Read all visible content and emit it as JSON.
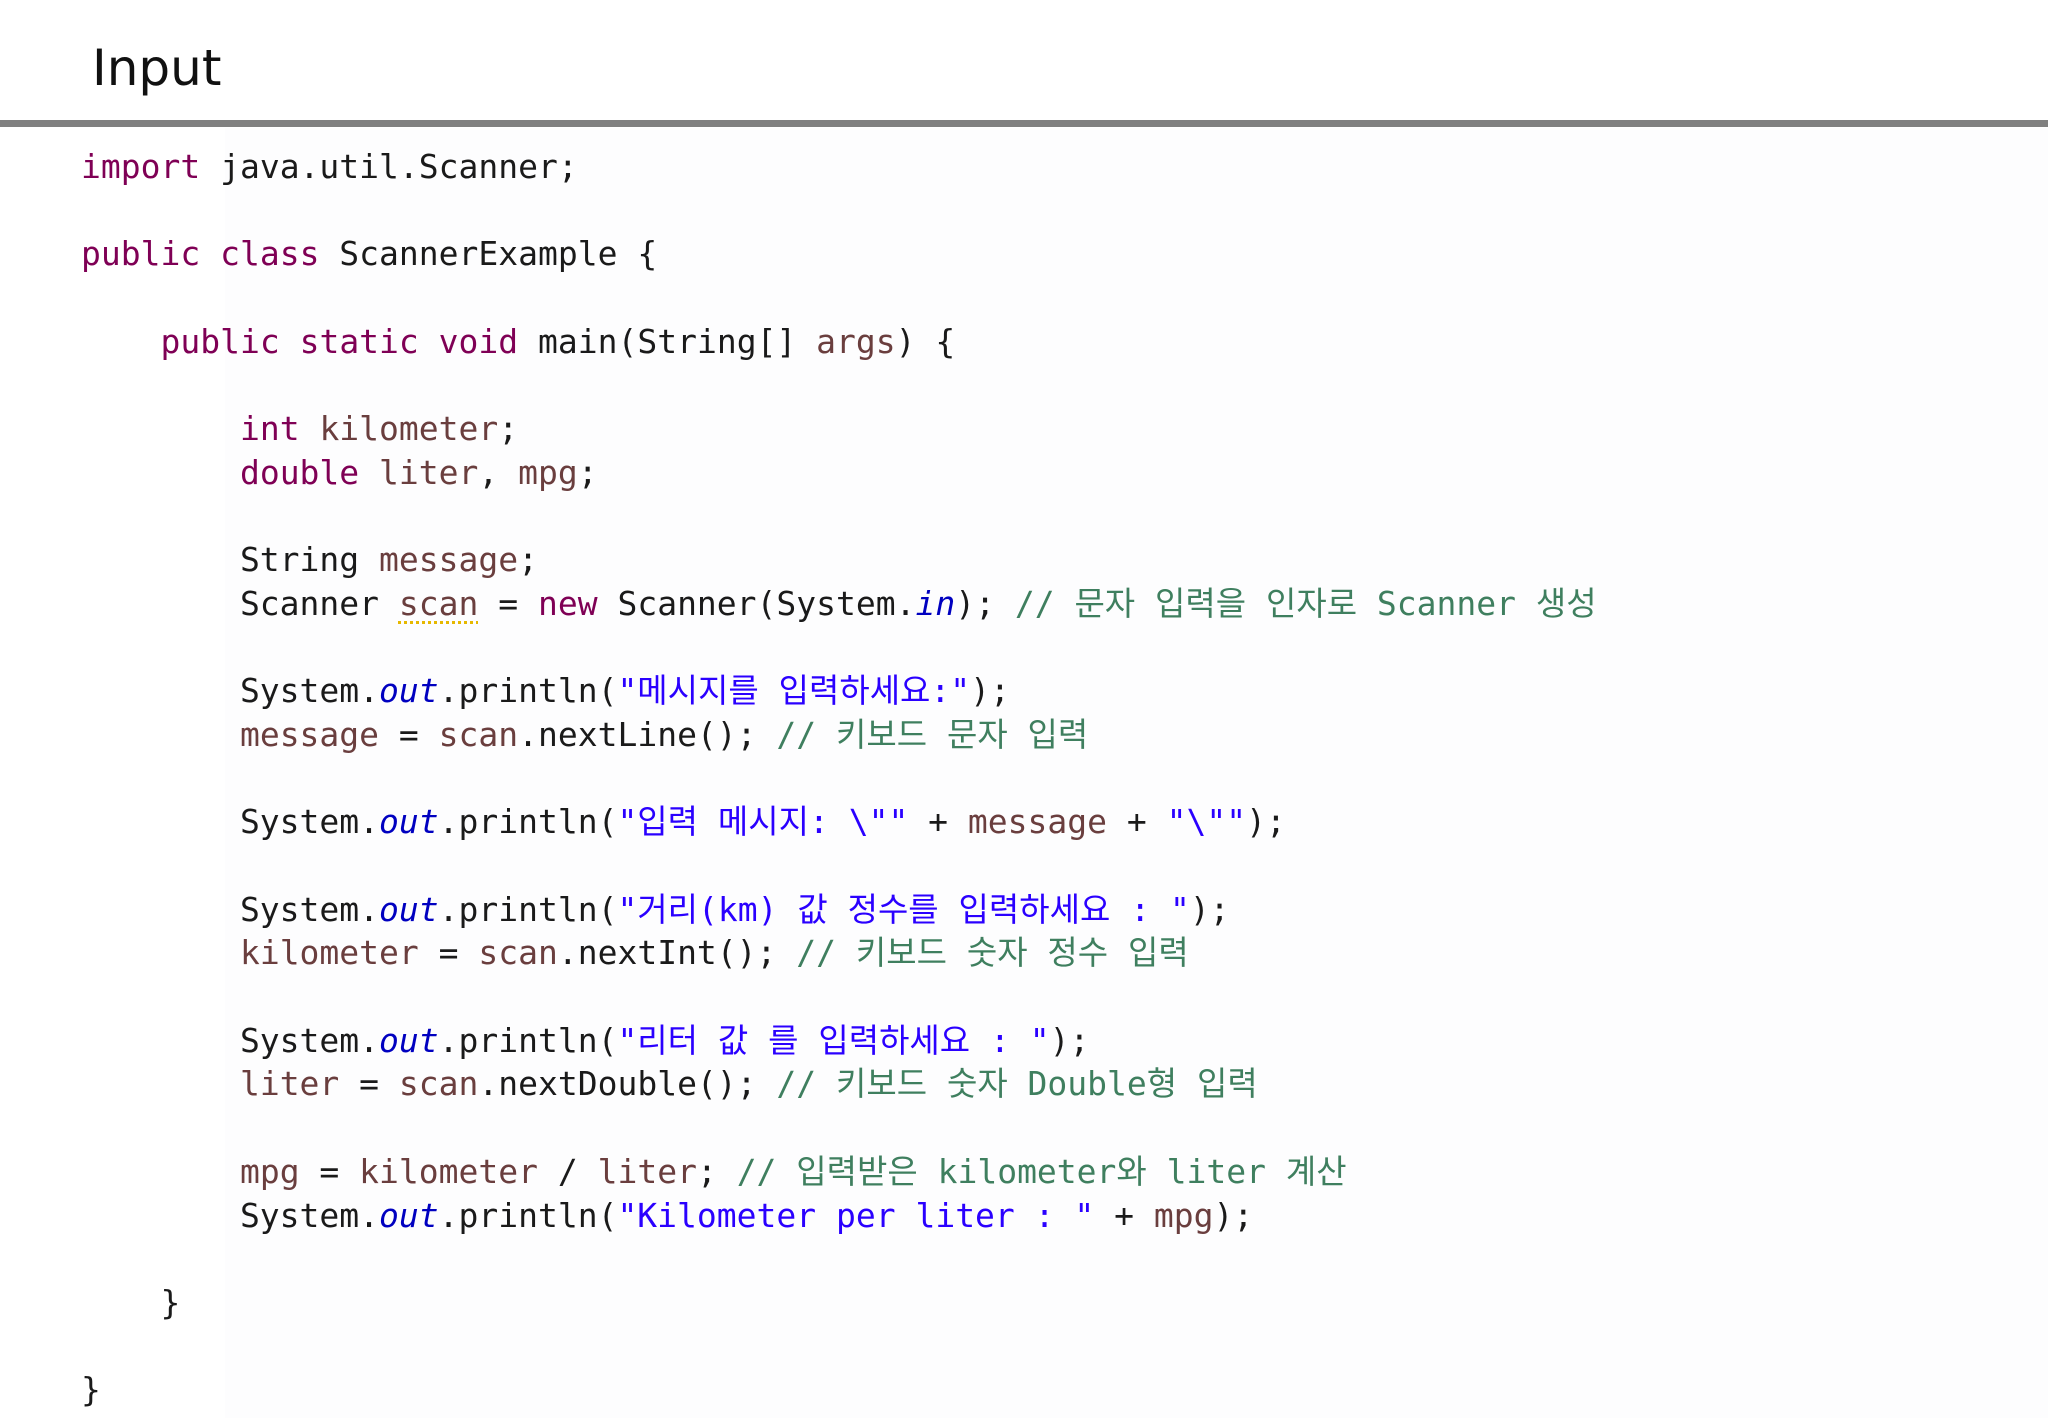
{
  "header": {
    "title": "Input"
  },
  "colors": {
    "keyword": "#7f0055",
    "variable": "#6a3e3e",
    "string": "#2a00ff",
    "comment": "#3f7f5f",
    "field": "#0000c0",
    "plain": "#1a1a1a",
    "warning_underline": "#e6b800",
    "rule": "#808080"
  },
  "code": {
    "lines": [
      [
        {
          "t": "kw",
          "v": "import"
        },
        {
          "t": "pl",
          "v": " java.util.Scanner;"
        }
      ],
      [],
      [
        {
          "t": "kw",
          "v": "public"
        },
        {
          "t": "pl",
          "v": " "
        },
        {
          "t": "kw",
          "v": "class"
        },
        {
          "t": "pl",
          "v": " ScannerExample {"
        }
      ],
      [],
      [
        {
          "t": "pl",
          "v": "    "
        },
        {
          "t": "kw",
          "v": "public"
        },
        {
          "t": "pl",
          "v": " "
        },
        {
          "t": "kw",
          "v": "static"
        },
        {
          "t": "pl",
          "v": " "
        },
        {
          "t": "kw",
          "v": "void"
        },
        {
          "t": "pl",
          "v": " main(String[] "
        },
        {
          "t": "var",
          "v": "args"
        },
        {
          "t": "pl",
          "v": ") {"
        }
      ],
      [],
      [
        {
          "t": "pl",
          "v": "        "
        },
        {
          "t": "kw",
          "v": "int"
        },
        {
          "t": "pl",
          "v": " "
        },
        {
          "t": "var",
          "v": "kilometer"
        },
        {
          "t": "pl",
          "v": ";"
        }
      ],
      [
        {
          "t": "pl",
          "v": "        "
        },
        {
          "t": "kw",
          "v": "double"
        },
        {
          "t": "pl",
          "v": " "
        },
        {
          "t": "var",
          "v": "liter"
        },
        {
          "t": "pl",
          "v": ", "
        },
        {
          "t": "var",
          "v": "mpg"
        },
        {
          "t": "pl",
          "v": ";"
        }
      ],
      [],
      [
        {
          "t": "pl",
          "v": "        String "
        },
        {
          "t": "var",
          "v": "message"
        },
        {
          "t": "pl",
          "v": ";"
        }
      ],
      [
        {
          "t": "pl",
          "v": "        Scanner "
        },
        {
          "t": "warn",
          "v": "scan"
        },
        {
          "t": "pl",
          "v": " = "
        },
        {
          "t": "kw",
          "v": "new"
        },
        {
          "t": "pl",
          "v": " Scanner(System."
        },
        {
          "t": "fld",
          "v": "in"
        },
        {
          "t": "pl",
          "v": "); "
        },
        {
          "t": "cmt",
          "v": "// 문자 입력을 인자로 Scanner 생성"
        }
      ],
      [],
      [
        {
          "t": "pl",
          "v": "        System."
        },
        {
          "t": "fld",
          "v": "out"
        },
        {
          "t": "pl",
          "v": ".println("
        },
        {
          "t": "str",
          "v": "\"메시지를 입력하세요:\""
        },
        {
          "t": "pl",
          "v": ");"
        }
      ],
      [
        {
          "t": "pl",
          "v": "        "
        },
        {
          "t": "var",
          "v": "message"
        },
        {
          "t": "pl",
          "v": " = "
        },
        {
          "t": "var",
          "v": "scan"
        },
        {
          "t": "pl",
          "v": ".nextLine(); "
        },
        {
          "t": "cmt",
          "v": "// 키보드 문자 입력"
        }
      ],
      [],
      [
        {
          "t": "pl",
          "v": "        System."
        },
        {
          "t": "fld",
          "v": "out"
        },
        {
          "t": "pl",
          "v": ".println("
        },
        {
          "t": "str",
          "v": "\"입력 메시지: \\\"\""
        },
        {
          "t": "pl",
          "v": " + "
        },
        {
          "t": "var",
          "v": "message"
        },
        {
          "t": "pl",
          "v": " + "
        },
        {
          "t": "str",
          "v": "\"\\\"\""
        },
        {
          "t": "pl",
          "v": ");"
        }
      ],
      [],
      [
        {
          "t": "pl",
          "v": "        System."
        },
        {
          "t": "fld",
          "v": "out"
        },
        {
          "t": "pl",
          "v": ".println("
        },
        {
          "t": "str",
          "v": "\"거리(km) 값 정수를 입력하세요 : \""
        },
        {
          "t": "pl",
          "v": ");"
        }
      ],
      [
        {
          "t": "pl",
          "v": "        "
        },
        {
          "t": "var",
          "v": "kilometer"
        },
        {
          "t": "pl",
          "v": " = "
        },
        {
          "t": "var",
          "v": "scan"
        },
        {
          "t": "pl",
          "v": ".nextInt(); "
        },
        {
          "t": "cmt",
          "v": "// 키보드 숫자 정수 입력"
        }
      ],
      [],
      [
        {
          "t": "pl",
          "v": "        System."
        },
        {
          "t": "fld",
          "v": "out"
        },
        {
          "t": "pl",
          "v": ".println("
        },
        {
          "t": "str",
          "v": "\"리터 값 를 입력하세요 : \""
        },
        {
          "t": "pl",
          "v": ");"
        }
      ],
      [
        {
          "t": "pl",
          "v": "        "
        },
        {
          "t": "var",
          "v": "liter"
        },
        {
          "t": "pl",
          "v": " = "
        },
        {
          "t": "var",
          "v": "scan"
        },
        {
          "t": "pl",
          "v": ".nextDouble(); "
        },
        {
          "t": "cmt",
          "v": "// 키보드 숫자 Double형 입력"
        }
      ],
      [],
      [
        {
          "t": "pl",
          "v": "        "
        },
        {
          "t": "var",
          "v": "mpg"
        },
        {
          "t": "pl",
          "v": " = "
        },
        {
          "t": "var",
          "v": "kilometer"
        },
        {
          "t": "pl",
          "v": " / "
        },
        {
          "t": "var",
          "v": "liter"
        },
        {
          "t": "pl",
          "v": "; "
        },
        {
          "t": "cmt",
          "v": "// 입력받은 kilometer와 liter 계산"
        }
      ],
      [
        {
          "t": "pl",
          "v": "        System."
        },
        {
          "t": "fld",
          "v": "out"
        },
        {
          "t": "pl",
          "v": ".println("
        },
        {
          "t": "str",
          "v": "\"Kilometer per liter : \""
        },
        {
          "t": "pl",
          "v": " + "
        },
        {
          "t": "var",
          "v": "mpg"
        },
        {
          "t": "pl",
          "v": ");"
        }
      ],
      [],
      [
        {
          "t": "pl",
          "v": "    }"
        }
      ],
      [],
      [
        {
          "t": "pl",
          "v": "}"
        }
      ]
    ]
  }
}
